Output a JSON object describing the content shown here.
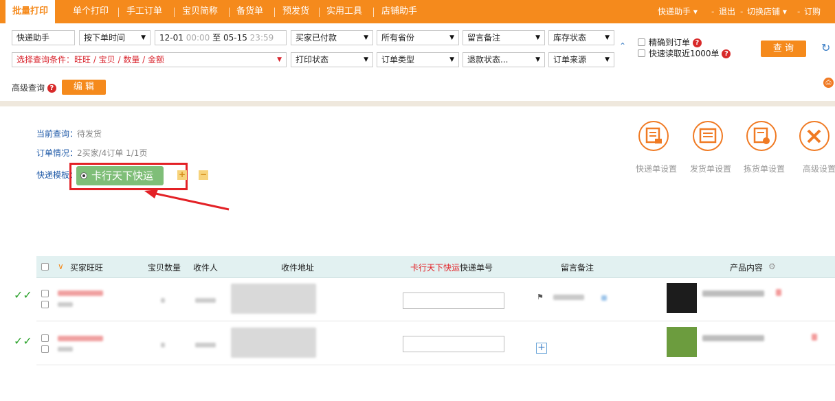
{
  "topnav": {
    "tabs": [
      "批量打印",
      "单个打印",
      "手工订单",
      "宝贝简称",
      "备货单",
      "预发货",
      "实用工具",
      "店铺助手"
    ],
    "right_links": [
      "快递助手",
      "退出",
      "切换店铺",
      "订购"
    ]
  },
  "filters": {
    "account": "快递助手",
    "sort": "按下单时间",
    "date_start": "12-01",
    "time_start": "00:00",
    "date_sep": "至",
    "date_end": "05-15",
    "time_end": "23:59",
    "pay_status": "买家已付款",
    "province": "所有省份",
    "remark": "留言备注",
    "stock": "库存状态",
    "condition_placeholder": "选择查询条件：旺旺 / 宝贝 / 数量 / 金额",
    "print_status": "打印状态",
    "order_type": "订单类型",
    "refund_status": "退款状态...",
    "order_source": "订单来源",
    "exact_order": "精确到订单",
    "fast_read": "快速读取近1000单",
    "query_button": "查 询",
    "advanced_label": "高级查询",
    "edit_button": "编 辑"
  },
  "info": {
    "current_query_label": "当前查询：",
    "current_query_value": "待发货",
    "order_status_label": "订单情况：",
    "order_status_value": "2买家/4订单  1/1页",
    "template_label": "快递模板：",
    "template_name": "卡行天下快运",
    "add": "+",
    "remove": "−"
  },
  "tools": [
    "快递单设置",
    "发货单设置",
    "拣货单设置",
    "高级设置"
  ],
  "table": {
    "headers": {
      "buyer": "买家旺旺",
      "qty": "宝贝数量",
      "receiver": "收件人",
      "address": "收件地址",
      "tracking_prefix": "卡行天下快运",
      "tracking_suffix": "快递单号",
      "remark": "留言备注",
      "product": "产品内容"
    },
    "rows": [
      {
        "status": "✓✓"
      },
      {
        "status": "✓✓"
      }
    ]
  },
  "colors": {
    "accent": "#f58a1c",
    "link_blue": "#1f5aa8",
    "alert_red": "#e32126",
    "template_green": "#7fbe78"
  }
}
